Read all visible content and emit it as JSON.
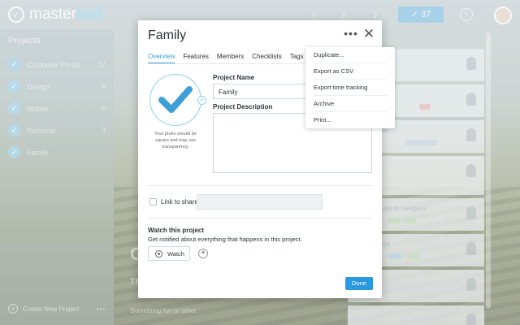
{
  "app": {
    "logo_part1": "master",
    "logo_part2": "task",
    "notifications_count": "37"
  },
  "sidebar": {
    "title": "Projects",
    "items": [
      {
        "label": "Customer Portal",
        "count": "12"
      },
      {
        "label": "Design",
        "count": "8"
      },
      {
        "label": "Mobile",
        "count": "5"
      },
      {
        "label": "Personal",
        "count": "3"
      },
      {
        "label": "Family",
        "count": ""
      }
    ],
    "create_label": "Create New Project"
  },
  "background": {
    "headline": "G",
    "subline": "Th",
    "footer": "Something fun or other"
  },
  "cards": [
    {
      "title": ""
    },
    {
      "title": ""
    },
    {
      "title": "ter"
    },
    {
      "title": ""
    },
    {
      "title": "side to navigate"
    },
    {
      "title": "Wa"
    },
    {
      "title": ""
    },
    {
      "title": ""
    },
    {
      "title": "ck"
    }
  ],
  "modal": {
    "title": "Family",
    "more_icon": "more-horizontal-icon",
    "close_icon": "close-icon",
    "tabs": [
      "Overview",
      "Features",
      "Members",
      "Checklists",
      "Tags"
    ],
    "active_tab": "Overview",
    "photo_note": "Your photo should be square and may use transparency.",
    "project_name_label": "Project Name",
    "project_name_value": "Family",
    "project_description_label": "Project Description",
    "project_description_value": "",
    "link_to_share_label": "Link to share",
    "link_to_share_value": "",
    "watch_title": "Watch this project",
    "watch_description": "Get notified about everything that happens in this project.",
    "watch_button": "Watch",
    "done_button": "Done",
    "accent_color": "#2a9ae0"
  },
  "menu": {
    "items": [
      "Duplicate...",
      "Export as CSV",
      "Export time tracking",
      "Archive",
      "Print..."
    ]
  }
}
